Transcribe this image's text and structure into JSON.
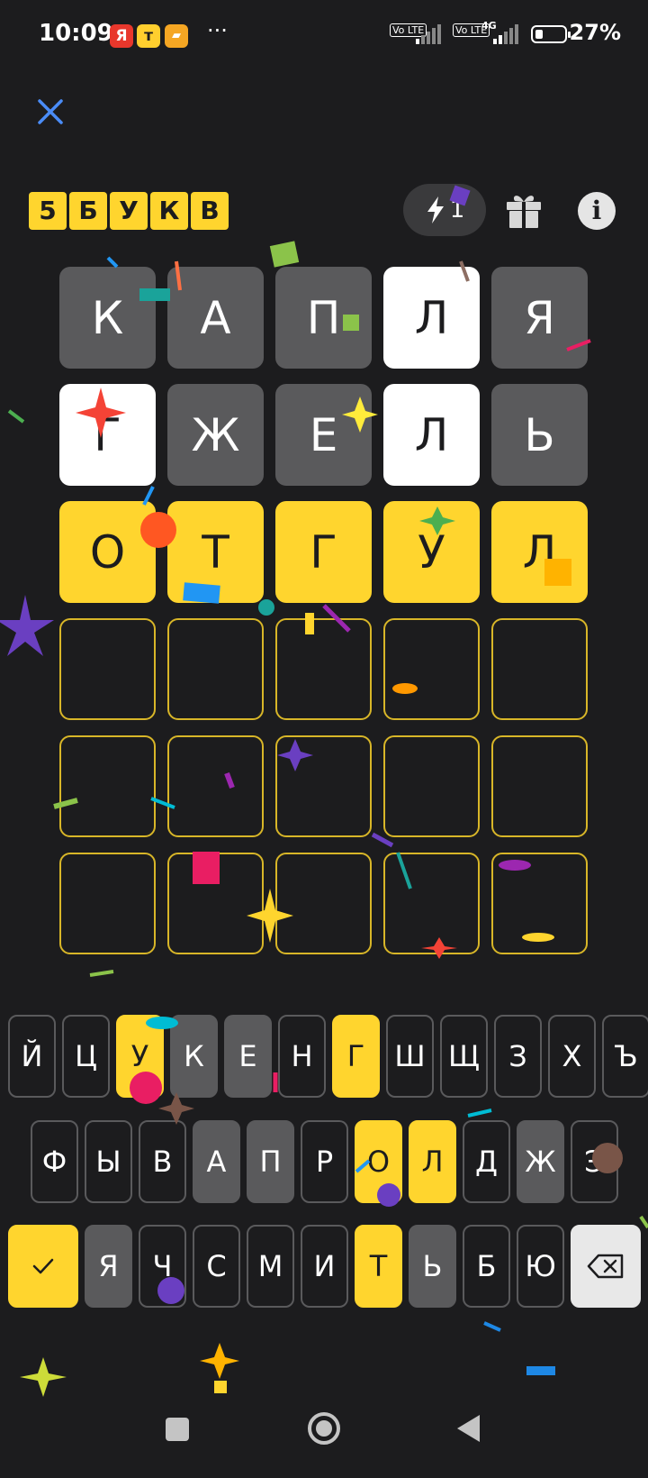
{
  "status_bar": {
    "time": "10:09",
    "apps": [
      {
        "icon": "yandex-app-icon",
        "glyph": "Я",
        "color": "#e8372c"
      },
      {
        "icon": "t-app-icon",
        "glyph": "т",
        "color": "#ffcf2e"
      },
      {
        "icon": "gallery-app-icon",
        "glyph": "▰",
        "color": "#f5a623"
      }
    ],
    "more": "···",
    "sim1": "Vo LTE",
    "sim2": "Vo LTE",
    "network": "4G",
    "battery_level": 0.27,
    "battery": "27%"
  },
  "header": {
    "close_icon": "close-icon",
    "logo_letters": [
      "5",
      "Б",
      "У",
      "К",
      "В"
    ],
    "hint_count": "1",
    "hint_icon": "lightning-icon",
    "gift_icon": "gift-icon",
    "info_label": "i"
  },
  "board": {
    "rows": [
      [
        {
          "l": "К",
          "s": "gray"
        },
        {
          "l": "А",
          "s": "gray"
        },
        {
          "l": "П",
          "s": "gray"
        },
        {
          "l": "Л",
          "s": "white"
        },
        {
          "l": "Я",
          "s": "gray"
        }
      ],
      [
        {
          "l": "Г",
          "s": "white"
        },
        {
          "l": "Ж",
          "s": "gray"
        },
        {
          "l": "Е",
          "s": "gray"
        },
        {
          "l": "Л",
          "s": "white"
        },
        {
          "l": "Ь",
          "s": "gray"
        }
      ],
      [
        {
          "l": "О",
          "s": "yellow"
        },
        {
          "l": "Т",
          "s": "yellow"
        },
        {
          "l": "Г",
          "s": "yellow"
        },
        {
          "l": "У",
          "s": "yellow"
        },
        {
          "l": "Л",
          "s": "yellow"
        }
      ],
      [
        {
          "l": "",
          "s": "empty"
        },
        {
          "l": "",
          "s": "empty"
        },
        {
          "l": "",
          "s": "empty"
        },
        {
          "l": "",
          "s": "empty"
        },
        {
          "l": "",
          "s": "empty"
        }
      ],
      [
        {
          "l": "",
          "s": "empty"
        },
        {
          "l": "",
          "s": "empty"
        },
        {
          "l": "",
          "s": "empty"
        },
        {
          "l": "",
          "s": "empty"
        },
        {
          "l": "",
          "s": "empty"
        }
      ],
      [
        {
          "l": "",
          "s": "empty"
        },
        {
          "l": "",
          "s": "empty"
        },
        {
          "l": "",
          "s": "empty"
        },
        {
          "l": "",
          "s": "empty"
        },
        {
          "l": "",
          "s": "empty"
        }
      ]
    ]
  },
  "keyboard": {
    "row1": [
      {
        "k": "Й",
        "s": "none"
      },
      {
        "k": "Ц",
        "s": "none"
      },
      {
        "k": "У",
        "s": "yellow"
      },
      {
        "k": "К",
        "s": "gray"
      },
      {
        "k": "Е",
        "s": "gray"
      },
      {
        "k": "Н",
        "s": "none"
      },
      {
        "k": "Г",
        "s": "yellow"
      },
      {
        "k": "Ш",
        "s": "none"
      },
      {
        "k": "Щ",
        "s": "none"
      },
      {
        "k": "З",
        "s": "none"
      },
      {
        "k": "Х",
        "s": "none"
      },
      {
        "k": "Ъ",
        "s": "none"
      }
    ],
    "row2": [
      {
        "k": "Ф",
        "s": "none"
      },
      {
        "k": "Ы",
        "s": "none"
      },
      {
        "k": "В",
        "s": "none"
      },
      {
        "k": "А",
        "s": "gray"
      },
      {
        "k": "П",
        "s": "gray"
      },
      {
        "k": "Р",
        "s": "none"
      },
      {
        "k": "О",
        "s": "yellow"
      },
      {
        "k": "Л",
        "s": "yellow"
      },
      {
        "k": "Д",
        "s": "none"
      },
      {
        "k": "Ж",
        "s": "gray"
      },
      {
        "k": "Э",
        "s": "none"
      }
    ],
    "row3": [
      {
        "k": "Я",
        "s": "gray"
      },
      {
        "k": "Ч",
        "s": "none"
      },
      {
        "k": "С",
        "s": "none"
      },
      {
        "k": "М",
        "s": "none"
      },
      {
        "k": "И",
        "s": "none"
      },
      {
        "k": "Т",
        "s": "yellow"
      },
      {
        "k": "Ь",
        "s": "gray"
      },
      {
        "k": "Б",
        "s": "none"
      },
      {
        "k": "Ю",
        "s": "none"
      }
    ],
    "enter_icon": "check-icon",
    "backspace_icon": "backspace-icon"
  },
  "navbar": {
    "recents_icon": "recents-square-icon",
    "home_icon": "home-circle-icon",
    "back_icon": "back-triangle-icon"
  },
  "colors": {
    "background": "#1c1c1e",
    "absent": "#5a5a5c",
    "present": "#ffffff",
    "correct": "#ffd52e",
    "empty_border": "#d8b628"
  }
}
